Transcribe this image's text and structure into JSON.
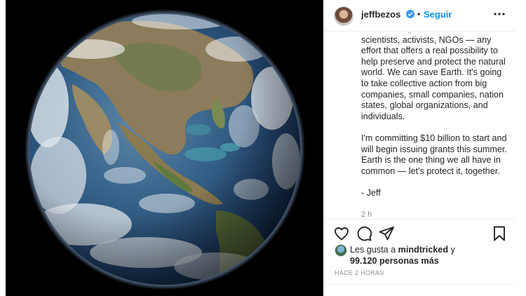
{
  "post": {
    "username": "jeffbezos",
    "separator": "•",
    "follow_label": "Seguir",
    "caption": {
      "paragraph1": "share. This global initiative will fund scientists, activists, NGOs — any effort that offers a real possibility to help preserve and protect the natural world. We can save Earth. It's going to take collective action from big companies, small companies, nation states, global organizations, and individuals.",
      "paragraph2": "I'm committing $10 billion to start and will begin issuing grants this summer. Earth is the one thing we all have in common — let's protect it, together.",
      "signature": "- Jeff",
      "relative_time": "2 h"
    },
    "likes": {
      "prefix": "Les gusta a",
      "liker": "mindtricked",
      "conjunction": "y",
      "others": "99.120 personas más"
    },
    "posted_time": "HACE 2 HORAS"
  },
  "icons": {
    "verified": "verified-badge-icon",
    "more": "more-options-icon",
    "like": "heart-icon",
    "comment": "comment-icon",
    "share": "share-icon",
    "save": "bookmark-icon"
  },
  "colors": {
    "accent": "#0095f6",
    "verified": "#3897f0",
    "text": "#262626",
    "muted": "#8e8e8e",
    "border": "#dbdbdb"
  }
}
